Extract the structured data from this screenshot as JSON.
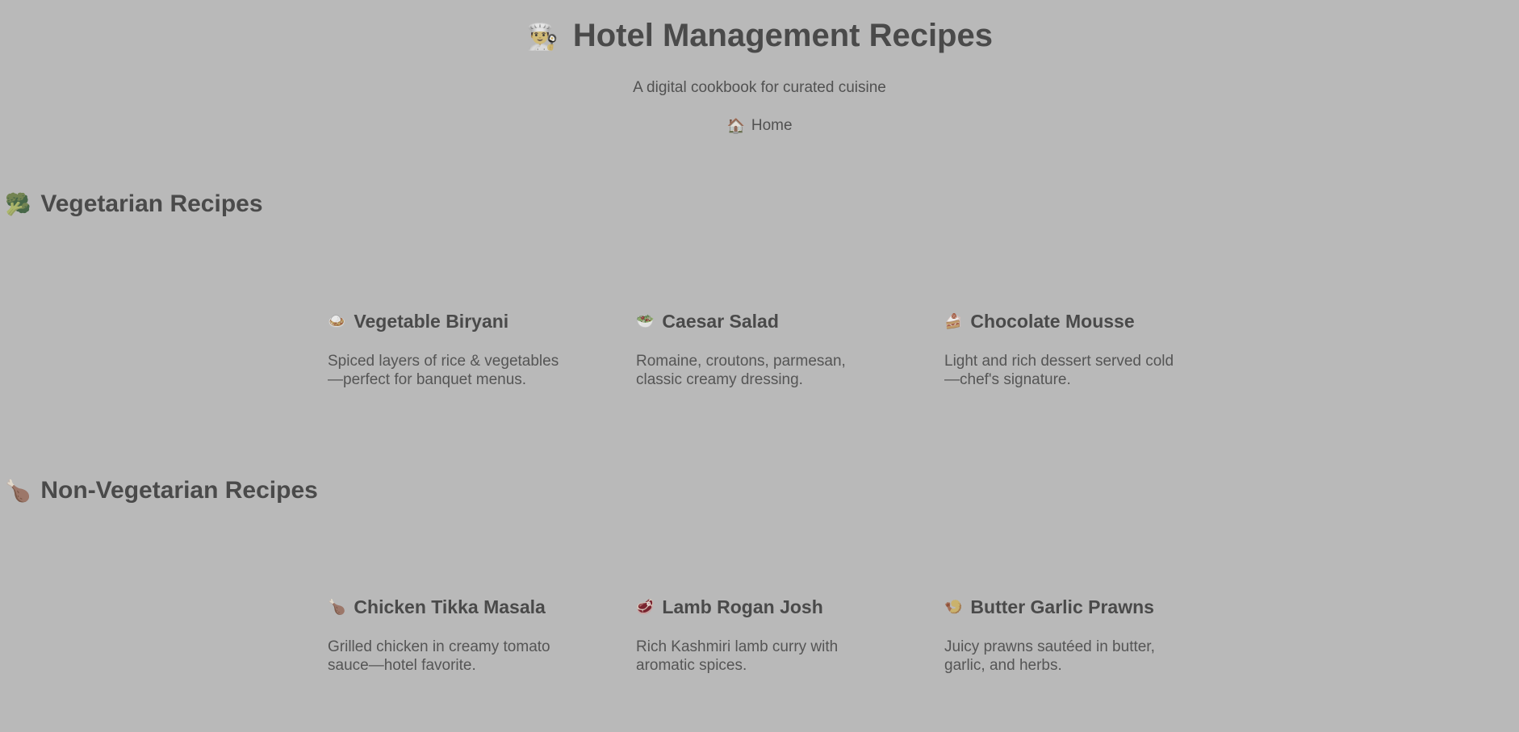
{
  "header": {
    "title_icon": "👨‍🍳",
    "title": "Hotel Management Recipes",
    "subtitle": "A digital cookbook for curated cuisine",
    "nav": {
      "icon": "🏠",
      "label": "Home"
    }
  },
  "sections": [
    {
      "icon": "🥦",
      "heading": "Vegetarian Recipes",
      "recipes": [
        {
          "icon": "🍛",
          "title": "Vegetable Biryani",
          "description": "Spiced layers of rice & vegetables —perfect for banquet menus."
        },
        {
          "icon": "🥗",
          "title": "Caesar Salad",
          "description": "Romaine, croutons, parmesan, classic creamy dressing."
        },
        {
          "icon": "🍰",
          "title": "Chocolate Mousse",
          "description": "Light and rich dessert served cold —chef's signature."
        }
      ]
    },
    {
      "icon": "🍗",
      "heading": "Non-Vegetarian Recipes",
      "recipes": [
        {
          "icon": "🍗",
          "title": "Chicken Tikka Masala",
          "description": "Grilled chicken in creamy tomato sauce—hotel favorite."
        },
        {
          "icon": "🥩",
          "title": "Lamb Rogan Josh",
          "description": "Rich Kashmiri lamb curry with aromatic spices."
        },
        {
          "icon": "🍤",
          "title": "Butter Garlic Prawns",
          "description": "Juicy prawns sautéed in butter, garlic, and herbs."
        }
      ]
    }
  ],
  "colors": {
    "background": "#b9b9b9",
    "heading_text": "#4a4a4a",
    "body_text": "#555555"
  }
}
